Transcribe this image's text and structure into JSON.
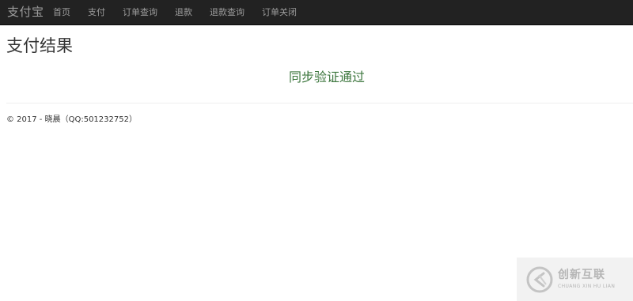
{
  "navbar": {
    "brand": "支付宝",
    "items": [
      {
        "label": "首页"
      },
      {
        "label": "支付"
      },
      {
        "label": "订单查询"
      },
      {
        "label": "退款"
      },
      {
        "label": "退款查询"
      },
      {
        "label": "订单关闭"
      }
    ]
  },
  "main": {
    "title": "支付结果",
    "message": "同步验证通过"
  },
  "footer": {
    "text": "© 2017 - 晓晨（QQ:501232752）"
  },
  "watermark": {
    "title": "创新互联",
    "subtitle": "CHUANG XIN HU LIAN"
  },
  "colors": {
    "navbar_bg": "#222222",
    "nav_text": "#9d9d9d",
    "success_text": "#3c763d",
    "watermark_bg": "#f2f2f2"
  }
}
